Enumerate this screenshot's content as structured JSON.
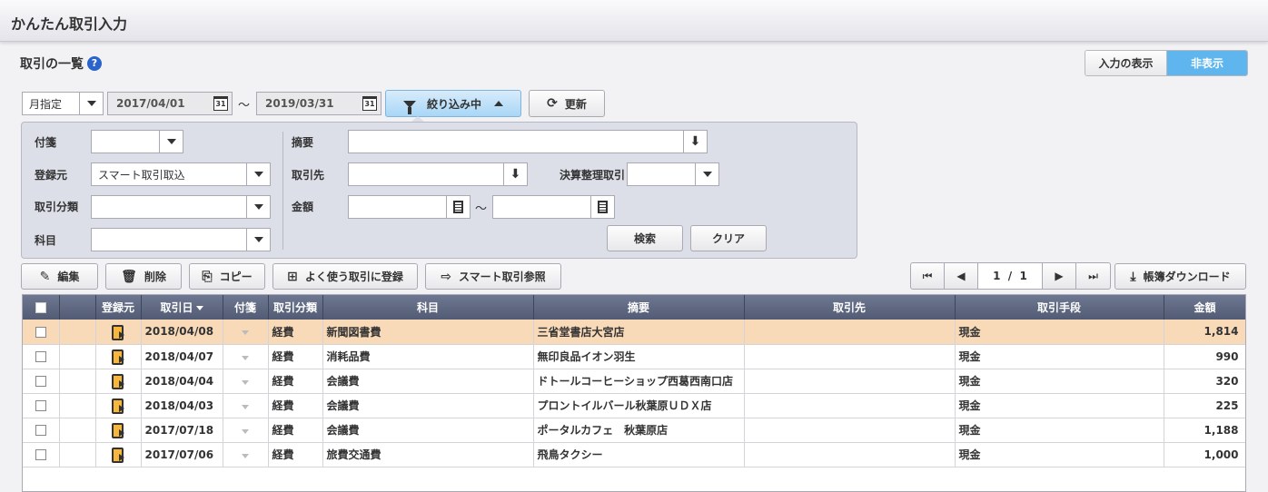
{
  "app": {
    "title": "かんたん取引入力"
  },
  "section": {
    "title": "取引の一覧",
    "help": "?"
  },
  "toggle": {
    "show_label": "入力の表示",
    "hide_label": "非表示"
  },
  "period": {
    "mode": "月指定",
    "from": "2017/04/01",
    "separator": "～",
    "to": "2019/03/31",
    "cal_glyph": "31"
  },
  "toolbar_top": {
    "filter_label": "絞り込み中",
    "refresh_label": "更新"
  },
  "filter": {
    "tag_label": "付箋",
    "tag_value": "",
    "source_label": "登録元",
    "source_value": "スマート取引取込",
    "category_label": "取引分類",
    "category_value": "",
    "account_label": "科目",
    "account_value": "",
    "memo_label": "摘要",
    "memo_value": "",
    "partner_label": "取引先",
    "partner_value": "",
    "closing_label": "決算整理取引",
    "closing_value": "",
    "amount_label": "金額",
    "amount_from": "",
    "amount_separator": "～",
    "amount_to": "",
    "search_label": "検索",
    "clear_label": "クリア"
  },
  "actions": {
    "edit": "編集",
    "delete": "削除",
    "copy": "コピー",
    "register_frequent": "よく使う取引に登録",
    "smart_ref": "スマート取引参照",
    "download": "帳簿ダウンロード"
  },
  "pager": {
    "page": "1",
    "slash": "/",
    "total": "1"
  },
  "table": {
    "headers": {
      "source": "登録元",
      "date": "取引日",
      "tag": "付箋",
      "category": "取引分類",
      "account": "科目",
      "memo": "摘要",
      "partner": "取引先",
      "method": "取引手段",
      "amount": "金額"
    },
    "rows": [
      {
        "date": "2018/04/08",
        "category": "経費",
        "account": "新聞図書費",
        "memo": "三省堂書店大宮店",
        "partner": "",
        "method": "現金",
        "amount": "1,814"
      },
      {
        "date": "2018/04/07",
        "category": "経費",
        "account": "消耗品費",
        "memo": "無印良品イオン羽生",
        "partner": "",
        "method": "現金",
        "amount": "990"
      },
      {
        "date": "2018/04/04",
        "category": "経費",
        "account": "会議費",
        "memo": "ドトールコーヒーショップ西葛西南口店",
        "partner": "",
        "method": "現金",
        "amount": "320"
      },
      {
        "date": "2018/04/03",
        "category": "経費",
        "account": "会議費",
        "memo": "プロントイルバール秋葉原ＵＤＸ店",
        "partner": "",
        "method": "現金",
        "amount": "225"
      },
      {
        "date": "2017/07/18",
        "category": "経費",
        "account": "会議費",
        "memo": "ポータルカフェ　秋葉原店",
        "partner": "",
        "method": "現金",
        "amount": "1,188"
      },
      {
        "date": "2017/07/06",
        "category": "経費",
        "account": "旅費交通費",
        "memo": "飛鳥タクシー",
        "partner": "",
        "method": "現金",
        "amount": "1,000"
      }
    ]
  },
  "colors": {
    "accent": "#5fb6ef",
    "selected_row": "#f8d9b8",
    "header_bg": "#5f6882"
  }
}
